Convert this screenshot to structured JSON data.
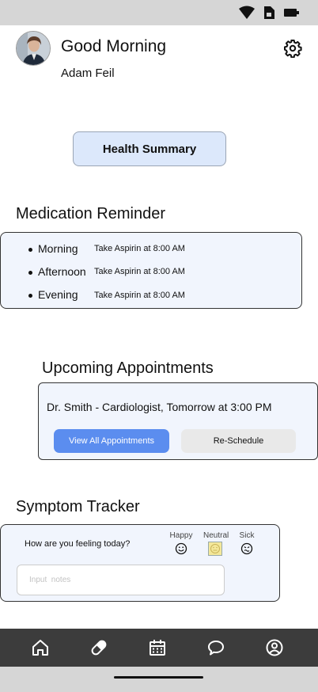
{
  "status_bar": {
    "icons": [
      "wifi-icon",
      "sim-card-icon",
      "battery-icon"
    ]
  },
  "header": {
    "greeting": "Good Morning",
    "user_name": "Adam Feil",
    "settings_icon": "gear-icon"
  },
  "health_summary": {
    "label": "Health Summary"
  },
  "medication": {
    "title": "Medication Reminder",
    "items": [
      {
        "time": "Morning",
        "instruction": "Take Aspirin at 8:00 AM"
      },
      {
        "time": "Afternoon",
        "instruction": "Take Aspirin at 8:00 AM"
      },
      {
        "time": "Evening",
        "instruction": "Take Aspirin at 8:00 AM"
      }
    ]
  },
  "appointments": {
    "title": "Upcoming Appointments",
    "next": "Dr. Smith - Cardiologist, Tomorrow at 3:00 PM",
    "view_all_label": "View All Appointments",
    "reschedule_label": "Re-Schedule"
  },
  "symptoms": {
    "title": "Symptom Tracker",
    "question": "How are you feeling today?",
    "moods": [
      {
        "label": "Happy",
        "selected": false
      },
      {
        "label": "Neutral",
        "selected": true
      },
      {
        "label": "Sick",
        "selected": false
      }
    ],
    "notes_placeholder": "Input  notes"
  },
  "nav": {
    "items": [
      "home-icon",
      "pill-icon",
      "calendar-icon",
      "chat-icon",
      "profile-icon"
    ]
  },
  "colors": {
    "card_bg": "#f1f5fd",
    "accent": "#5b8def",
    "summary_bg": "#dce8fb",
    "nav_bg": "#3c3c3c",
    "system_bar": "#d6d6d6"
  }
}
